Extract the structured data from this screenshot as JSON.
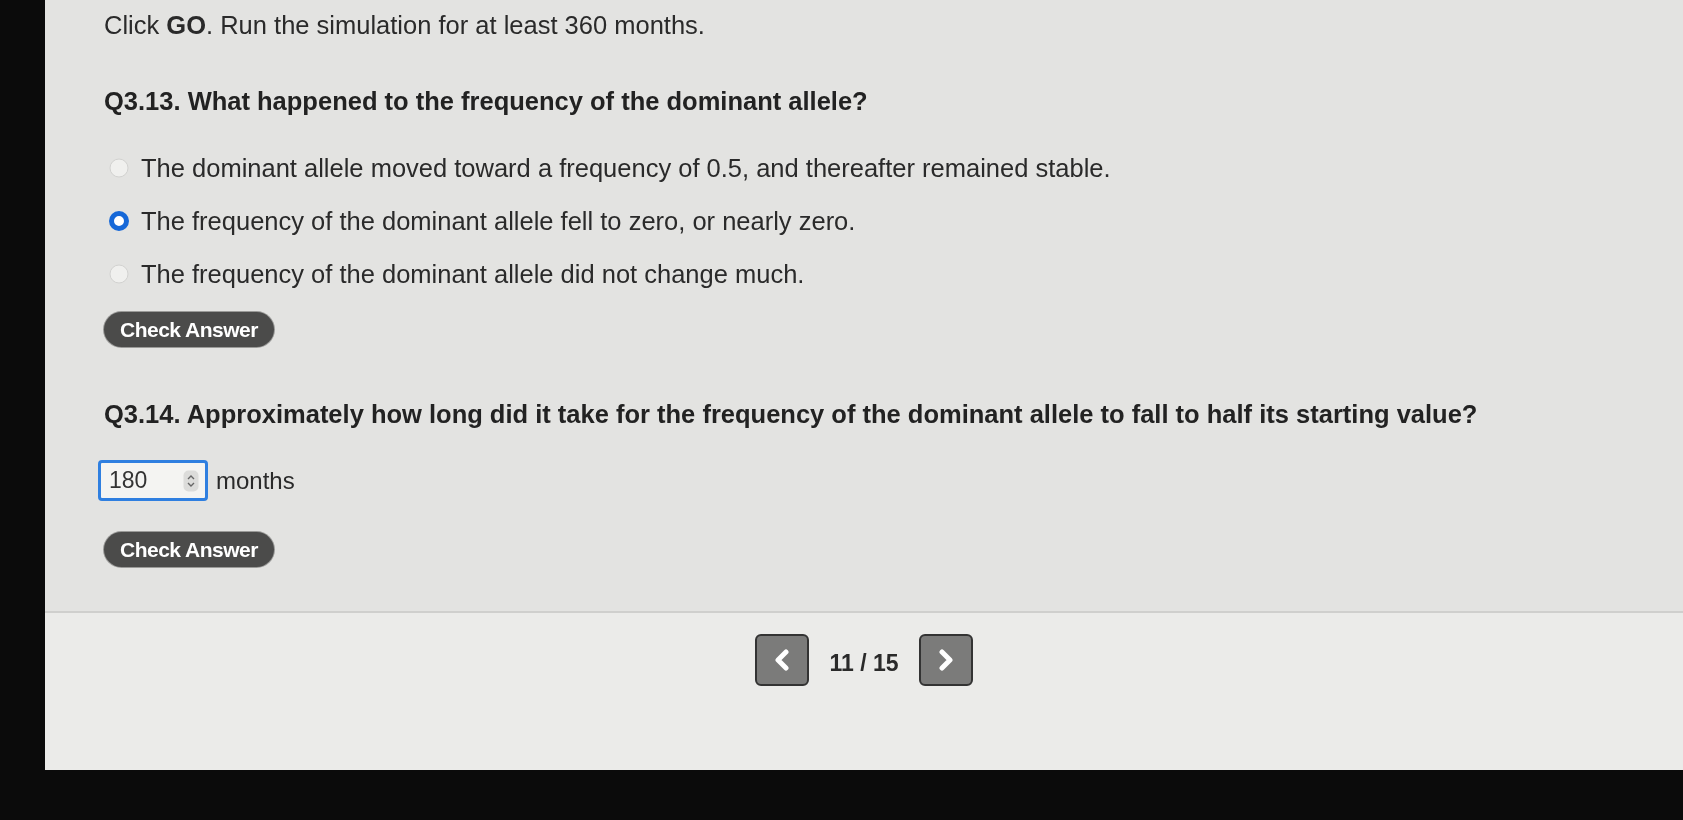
{
  "instruction": "Click **GO**. Run the simulation for at least 360 months.",
  "questions": [
    {
      "kind": "choice",
      "prompt": "Q3.13. What happened to the frequency of the dominant allele?",
      "options": [
        {
          "label": "The dominant allele moved toward a frequency of 0.5, and thereafter remained stable.",
          "selected": false
        },
        {
          "label": "The frequency of the dominant allele fell to zero, or nearly zero.",
          "selected": true
        },
        {
          "label": "The frequency of the dominant allele did not change much.",
          "selected": false
        }
      ],
      "button": "Check Answer"
    },
    {
      "kind": "number",
      "prompt": "Q3.14. Approximately how long did it take for the frequency of the dominant allele to fall to half its starting value?",
      "value": "180",
      "unit": "months",
      "button": "Check Answer"
    }
  ],
  "pagination": {
    "current": "11 / 15"
  }
}
